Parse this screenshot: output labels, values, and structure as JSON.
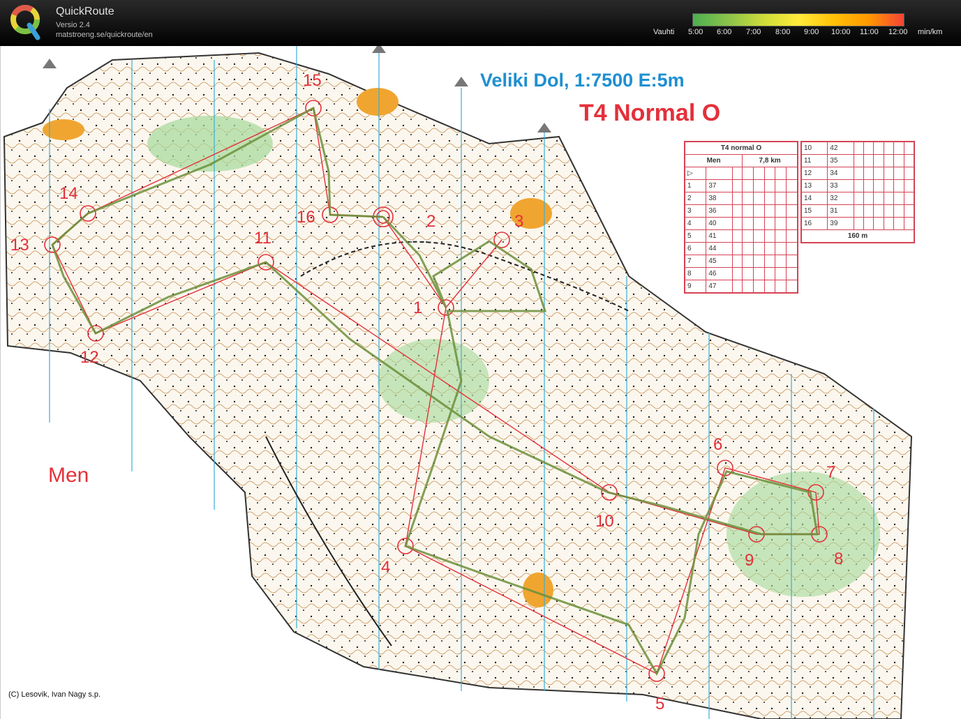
{
  "app": {
    "name": "QuickRoute",
    "version": "Versio 2.4",
    "url": "matstroeng.se/quickroute/en"
  },
  "pace_legend": {
    "label": "Vauhti",
    "ticks": [
      "5:00",
      "6:00",
      "7:00",
      "8:00",
      "9:00",
      "10:00",
      "11:00",
      "12:00"
    ],
    "unit": "min/km",
    "colors": [
      "#4caf50",
      "#8bc34a",
      "#cddc39",
      "#ffeb3b",
      "#ffc107",
      "#ff9800",
      "#f44336"
    ]
  },
  "map": {
    "title": "Veliki Dol, 1:7500 E:5m",
    "course": "T4 Normal O",
    "category": "Men",
    "copyright": "(C) Lesovik, Ivan Nagy s.p.",
    "controls": [
      "1",
      "2",
      "3",
      "4",
      "5",
      "6",
      "7",
      "8",
      "9",
      "10",
      "11",
      "12",
      "13",
      "14",
      "15",
      "16"
    ]
  },
  "description_sheet": {
    "title": "T4 normal O",
    "category": "Men",
    "length": "7,8 km",
    "finish_distance": "160 m",
    "rows_left": [
      {
        "n": "1",
        "code": "37"
      },
      {
        "n": "2",
        "code": "38"
      },
      {
        "n": "3",
        "code": "36"
      },
      {
        "n": "4",
        "code": "40"
      },
      {
        "n": "5",
        "code": "41"
      },
      {
        "n": "6",
        "code": "44"
      },
      {
        "n": "7",
        "code": "45"
      },
      {
        "n": "8",
        "code": "46"
      },
      {
        "n": "9",
        "code": "47"
      }
    ],
    "rows_right": [
      {
        "n": "10",
        "code": "42"
      },
      {
        "n": "11",
        "code": "35"
      },
      {
        "n": "12",
        "code": "34"
      },
      {
        "n": "13",
        "code": "33"
      },
      {
        "n": "14",
        "code": "32"
      },
      {
        "n": "15",
        "code": "31"
      },
      {
        "n": "16",
        "code": "39"
      }
    ]
  }
}
